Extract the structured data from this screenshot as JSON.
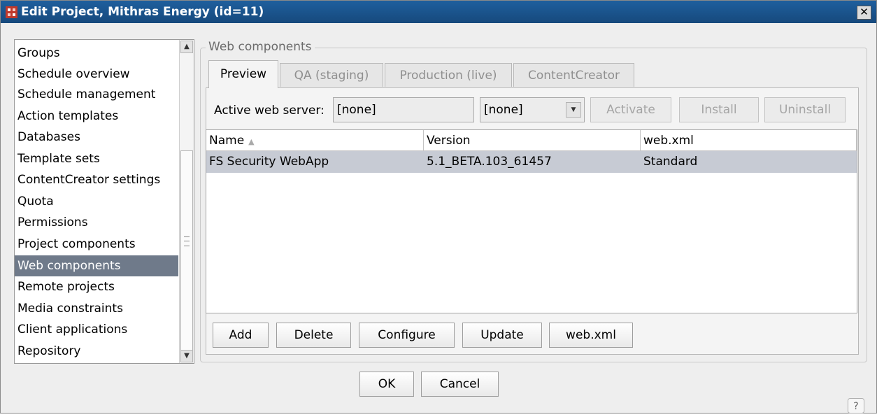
{
  "window": {
    "title": "Edit Project, Mithras Energy (id=11)",
    "close_label": "✕"
  },
  "sidebar": {
    "items": [
      {
        "label": "Groups"
      },
      {
        "label": "Schedule overview"
      },
      {
        "label": "Schedule management"
      },
      {
        "label": "Action templates"
      },
      {
        "label": "Databases"
      },
      {
        "label": "Template sets"
      },
      {
        "label": "ContentCreator settings"
      },
      {
        "label": "Quota"
      },
      {
        "label": "Permissions"
      },
      {
        "label": "Project components"
      },
      {
        "label": "Web components",
        "selected": true
      },
      {
        "label": "Remote projects"
      },
      {
        "label": "Media constraints"
      },
      {
        "label": "Client applications"
      },
      {
        "label": "Repository"
      }
    ]
  },
  "group": {
    "legend": "Web components"
  },
  "tabs": [
    {
      "label": "Preview",
      "active": true
    },
    {
      "label": "QA (staging)"
    },
    {
      "label": "Production (live)"
    },
    {
      "label": "ContentCreator"
    }
  ],
  "server": {
    "label": "Active web server:",
    "value": "[none]",
    "select_value": "[none]",
    "activate_label": "Activate",
    "install_label": "Install",
    "uninstall_label": "Uninstall"
  },
  "table": {
    "columns": [
      "Name",
      "Version",
      "web.xml"
    ],
    "sort_indicator": "▲",
    "rows": [
      {
        "name": "FS Security WebApp",
        "version": "5.1_BETA.103_61457",
        "webxml": "Standard"
      }
    ]
  },
  "actions": {
    "add": "Add",
    "delete": "Delete",
    "configure": "Configure",
    "update": "Update",
    "webxml": "web.xml"
  },
  "dialog": {
    "ok": "OK",
    "cancel": "Cancel",
    "help": "?"
  },
  "colors": {
    "titlebar": "#1f5f9e",
    "selection": "#6f7a8a",
    "row_selection": "#c7cbd4"
  }
}
